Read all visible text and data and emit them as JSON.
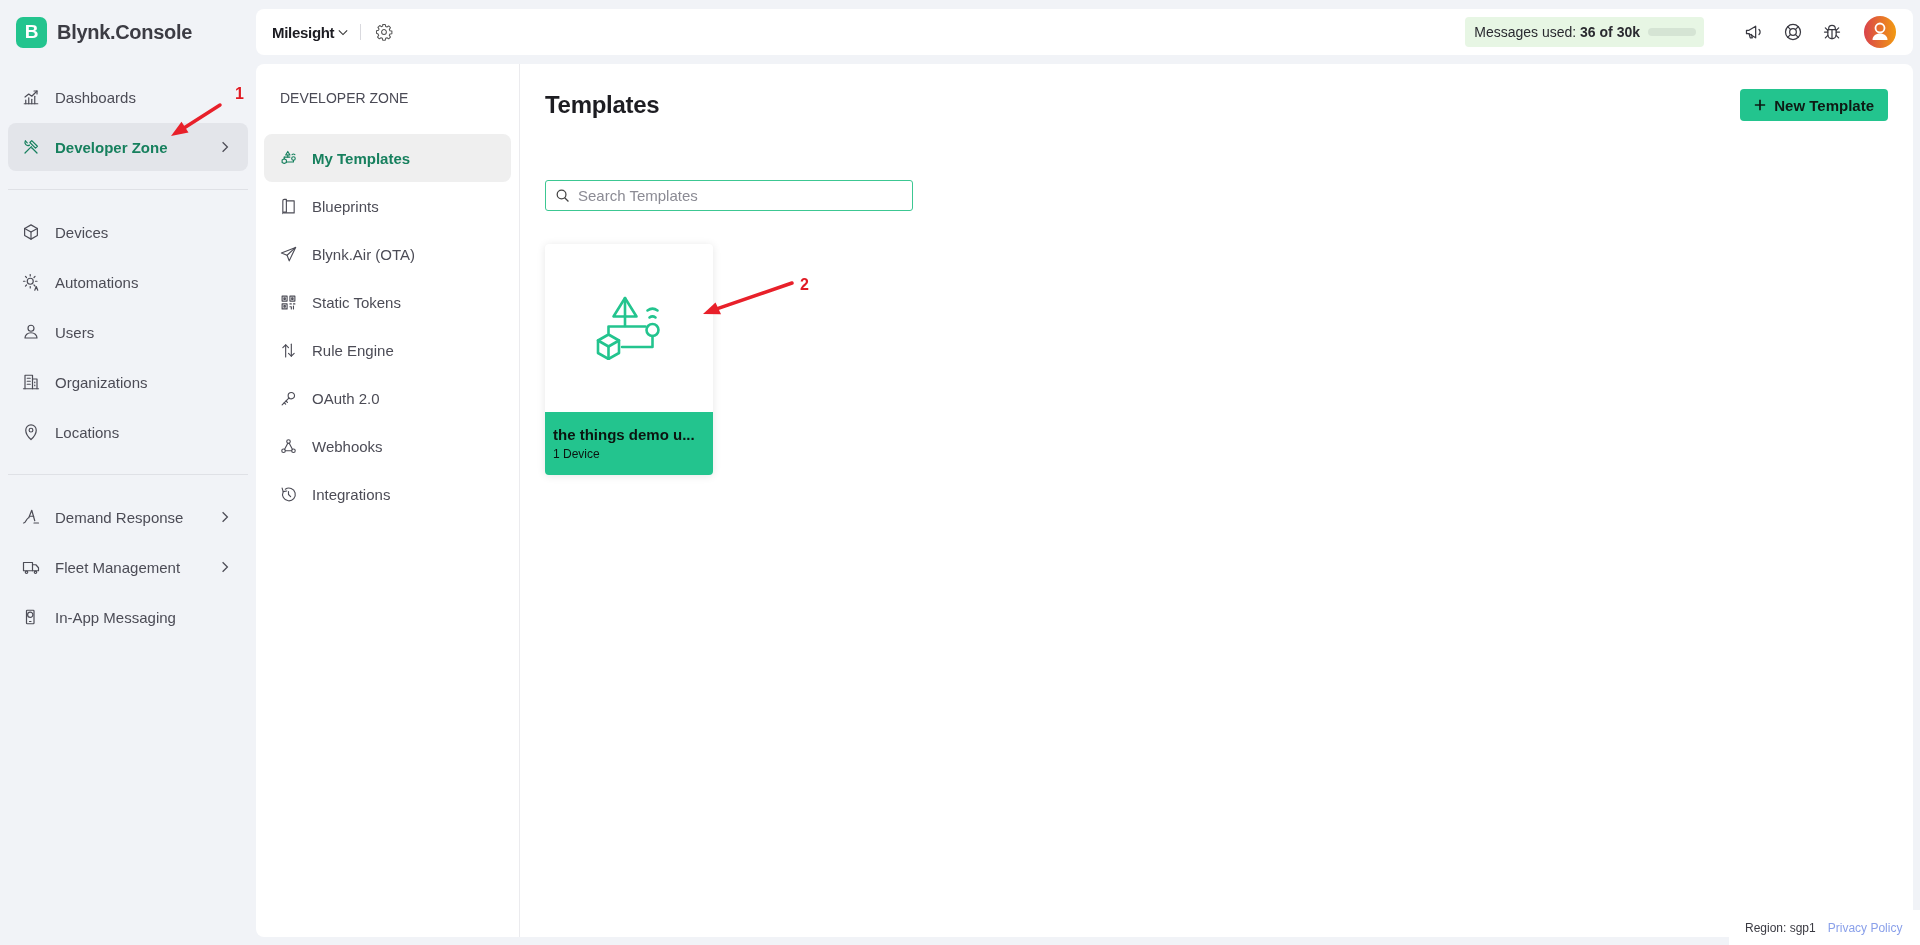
{
  "app": {
    "logo_letter": "B",
    "name": "Blynk.Console"
  },
  "sidebar": {
    "groups": [
      {
        "items": [
          {
            "label": "Dashboards",
            "selected": false,
            "has_submenu": false
          },
          {
            "label": "Developer Zone",
            "selected": true,
            "has_submenu": true
          }
        ]
      },
      {
        "items": [
          {
            "label": "Devices",
            "selected": false,
            "has_submenu": false
          },
          {
            "label": "Automations",
            "selected": false,
            "has_submenu": false
          },
          {
            "label": "Users",
            "selected": false,
            "has_submenu": false
          },
          {
            "label": "Organizations",
            "selected": false,
            "has_submenu": false
          },
          {
            "label": "Locations",
            "selected": false,
            "has_submenu": false
          }
        ]
      },
      {
        "items": [
          {
            "label": "Demand Response",
            "selected": false,
            "has_submenu": true
          },
          {
            "label": "Fleet Management",
            "selected": false,
            "has_submenu": true
          },
          {
            "label": "In-App Messaging",
            "selected": false,
            "has_submenu": false
          }
        ]
      }
    ]
  },
  "topbar": {
    "organization": "Milesight",
    "messages": {
      "text": "Messages used: **36 of 30k**",
      "level": 0.0012
    }
  },
  "developer_zone": {
    "heading": "DEVELOPER ZONE",
    "items": [
      {
        "label": "My Templates",
        "selected": true
      },
      {
        "label": "Blueprints",
        "selected": false
      },
      {
        "label": "Blynk.Air (OTA)",
        "selected": false
      },
      {
        "label": "Static Tokens",
        "selected": false
      },
      {
        "label": "Rule Engine",
        "selected": false
      },
      {
        "label": "OAuth 2.0",
        "selected": false
      },
      {
        "label": "Webhooks",
        "selected": false
      },
      {
        "label": "Integrations",
        "selected": false
      }
    ]
  },
  "templates": {
    "title": "Templates",
    "new_button": "New Template",
    "search": {
      "placeholder": "Search Templates"
    },
    "cards": [
      {
        "name": "the things demo u...",
        "devices": "1 Device"
      }
    ]
  },
  "annotations": [
    {
      "label": "1"
    },
    {
      "label": "2"
    }
  ],
  "footer": {
    "region": "Region: sgp1",
    "privacy_link": "Privacy Policy"
  }
}
